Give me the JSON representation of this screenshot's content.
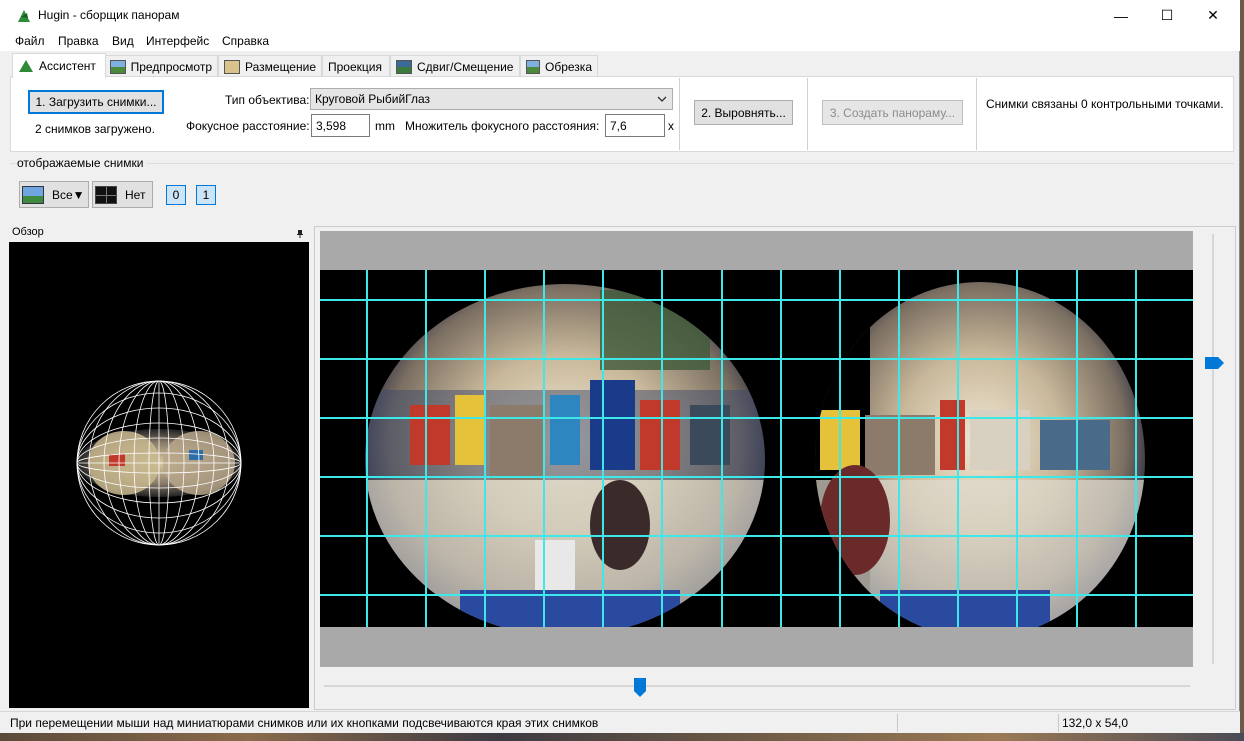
{
  "window": {
    "title": "Hugin - сборщик панорам",
    "controls": [
      "—",
      "☐",
      "✕"
    ]
  },
  "menu": [
    "Файл",
    "Правка",
    "Вид",
    "Интерфейс",
    "Справка"
  ],
  "tabs": [
    {
      "label": "Ассистент",
      "active": true
    },
    {
      "label": "Предпросмотр",
      "active": false
    },
    {
      "label": "Размещение",
      "active": false
    },
    {
      "label": "Проекция",
      "active": false
    },
    {
      "label": "Сдвиг/Смещение",
      "active": false
    },
    {
      "label": "Обрезка",
      "active": false
    }
  ],
  "assistant": {
    "load_button": "1. Загрузить снимки...",
    "loaded_text": "2 снимков загружено.",
    "lens_type_label": "Тип объектива:",
    "lens_type_value": "Круговой РыбийГлаз",
    "focal_label": "Фокусное расстояние:",
    "focal_value": "3,598",
    "focal_unit": "mm",
    "crop_label": "Множитель фокусного расстояния:",
    "crop_value": "7,6",
    "crop_unit": "x",
    "align_button": "2. Выровнять...",
    "create_button": "3. Создать панораму...",
    "status_text": "Снимки связаны 0 контрольными точками."
  },
  "visible_images": {
    "group_label": "отображаемые снимки",
    "all_button": "Все▼",
    "none_button": "Нет",
    "image_toggles": [
      "0",
      "1"
    ]
  },
  "overview": {
    "title": "Обзор",
    "pin": "📌"
  },
  "statusbar": {
    "message": "При перемещении мыши над миниатюрами снимков или их кнопками подсвечиваются края этих снимков",
    "dimensions": "132,0 x 54,0"
  },
  "colors": {
    "grid": "#3ee8e8",
    "accent": "#0078d7"
  },
  "sliders": {
    "vertical_value": 0.3,
    "horizontal_value": 0.37
  }
}
